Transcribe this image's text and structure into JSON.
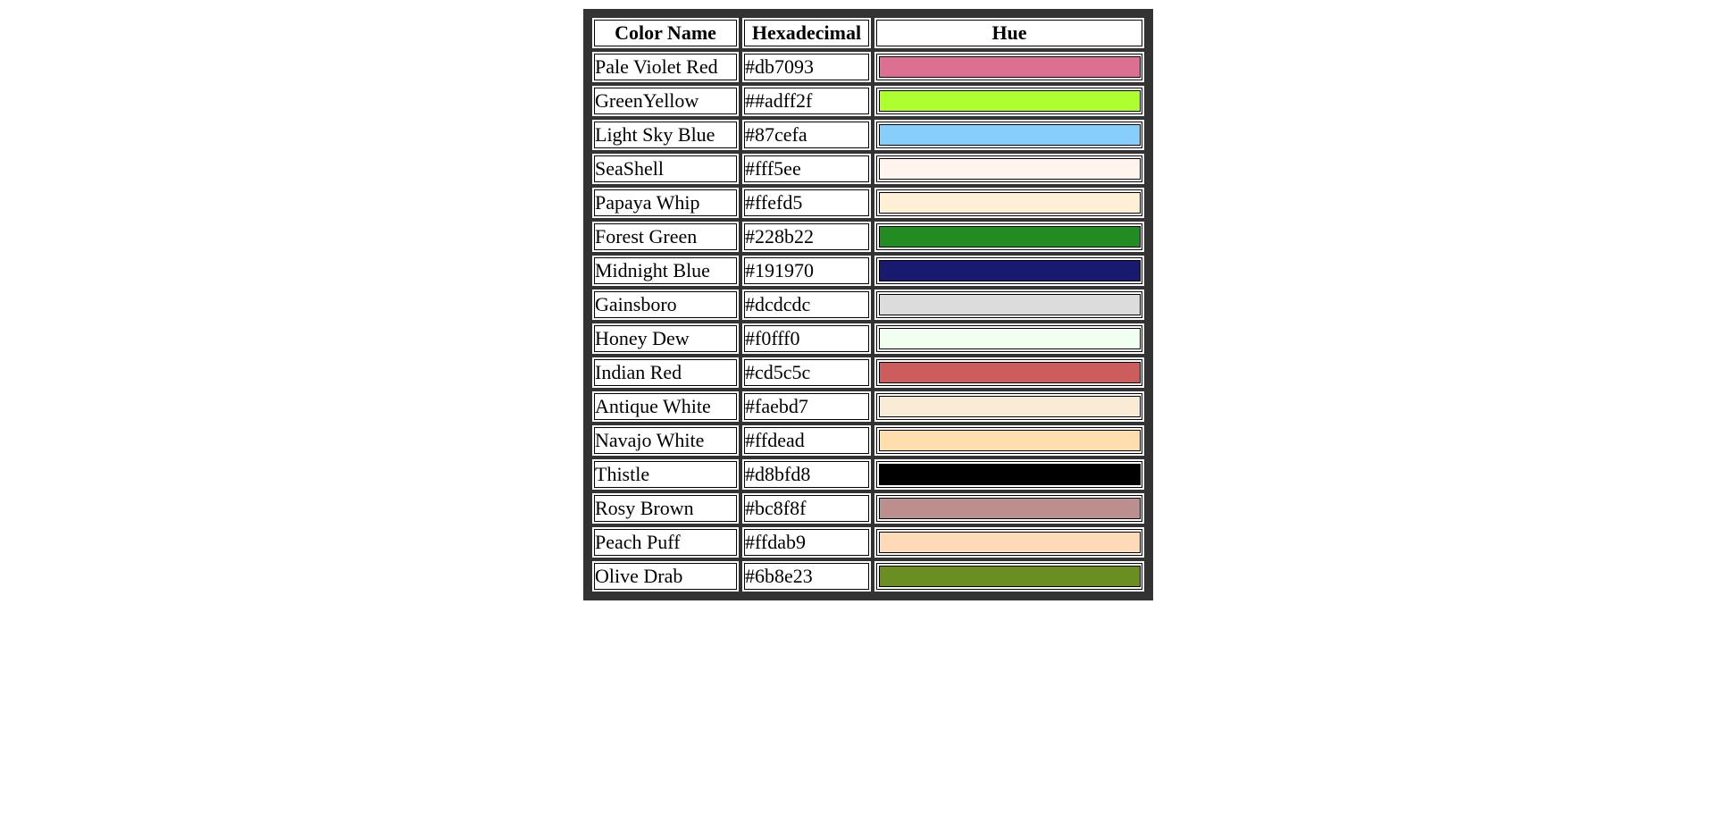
{
  "table": {
    "headers": [
      "Color Name",
      "Hexadecimal",
      "Hue"
    ],
    "rows": [
      {
        "name": "Pale Violet Red",
        "hex": "#db7093",
        "swatch": "#db7093"
      },
      {
        "name": "GreenYellow",
        "hex": "##adff2f",
        "swatch": "#adff2f"
      },
      {
        "name": "Light Sky Blue",
        "hex": "#87cefa",
        "swatch": "#87cefa"
      },
      {
        "name": "SeaShell",
        "hex": "#fff5ee",
        "swatch": "#fff5ee"
      },
      {
        "name": "Papaya Whip",
        "hex": "#ffefd5",
        "swatch": "#ffefd5"
      },
      {
        "name": "Forest Green",
        "hex": "#228b22",
        "swatch": "#228b22"
      },
      {
        "name": "Midnight Blue",
        "hex": "#191970",
        "swatch": "#191970"
      },
      {
        "name": "Gainsboro",
        "hex": "#dcdcdc",
        "swatch": "#dcdcdc"
      },
      {
        "name": "Honey Dew",
        "hex": "#f0fff0",
        "swatch": "#f0fff0"
      },
      {
        "name": "Indian Red",
        "hex": "#cd5c5c",
        "swatch": "#cd5c5c"
      },
      {
        "name": "Antique White",
        "hex": "#faebd7",
        "swatch": "#faebd7"
      },
      {
        "name": "Navajo White",
        "hex": "#ffdead",
        "swatch": "#ffdead"
      },
      {
        "name": "Thistle",
        "hex": "#d8bfd8",
        "swatch": "#000000"
      },
      {
        "name": "Rosy Brown",
        "hex": "#bc8f8f",
        "swatch": "#bc8f8f"
      },
      {
        "name": "Peach Puff",
        "hex": "#ffdab9",
        "swatch": "#ffdab9"
      },
      {
        "name": "Olive Drab",
        "hex": "#6b8e23",
        "swatch": "#6b8e23"
      }
    ]
  },
  "colors": {
    "table_border": "#333333",
    "cell_background": "#ffffff"
  }
}
